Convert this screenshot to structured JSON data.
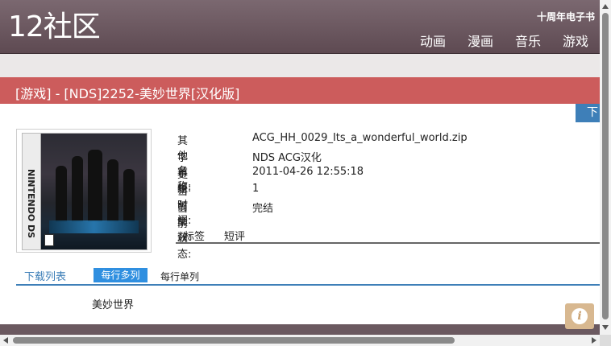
{
  "header": {
    "logo": "12社区",
    "tagline": "十周年电子书",
    "nav": [
      "动画",
      "漫画",
      "音乐",
      "游戏"
    ]
  },
  "title": "[游戏] - [NDS]2252-美妙世界[汉化版]",
  "download_button": "下",
  "cover": {
    "side_label": "NINTENDO DS"
  },
  "details": [
    {
      "key": "其他名称:",
      "value": "ACG_HH_0029_Its_a_wonderful_world.zip"
    },
    {
      "key": "字幕组:",
      "value": "NDS ACG汉化"
    },
    {
      "key": "更新时间:",
      "value": "2011-04-26 12:55:18"
    },
    {
      "key": "当前集数:",
      "value": "1"
    },
    {
      "key": "当前状态:",
      "value": "完结"
    }
  ],
  "subtabs": [
    "标签",
    "短评"
  ],
  "download_list": {
    "label": "下载列表",
    "multi": "每行多列",
    "single": "每行单列",
    "items": [
      "美妙世界"
    ]
  },
  "info_icon": "i",
  "colors": {
    "header": "#6b5960",
    "title_bar": "#cc5c5c",
    "accent_blue": "#3e7fb8",
    "pill_blue": "#2f8fe0"
  }
}
